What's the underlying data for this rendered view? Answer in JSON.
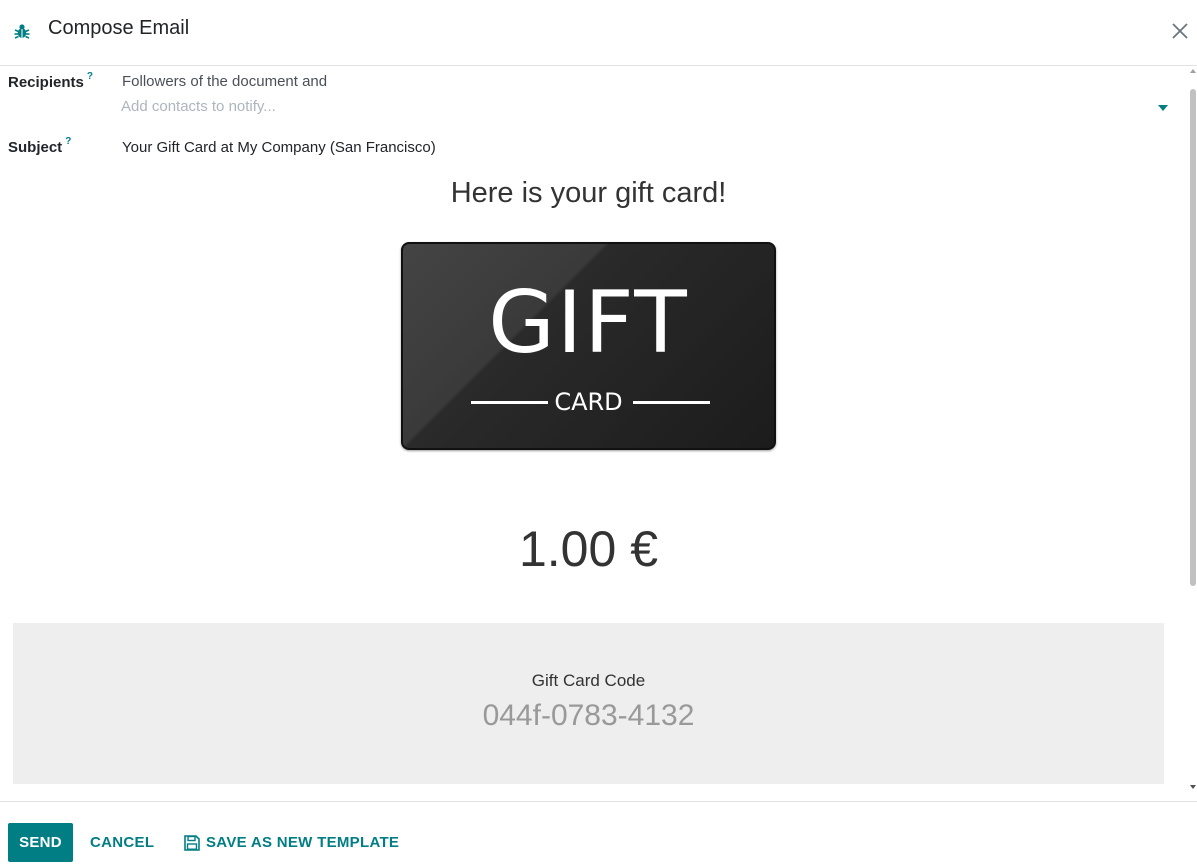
{
  "dialog": {
    "title": "Compose Email",
    "icons": {
      "header": "bug-icon",
      "close": "close-icon"
    }
  },
  "form": {
    "recipients": {
      "label": "Recipients",
      "help": "?",
      "followers_text": "Followers of the document and",
      "placeholder": "Add contacts to notify..."
    },
    "subject": {
      "label": "Subject",
      "help": "?",
      "value": "Your Gift Card at My Company (San Francisco)"
    }
  },
  "mail_body": {
    "heading": "Here is your gift card!",
    "card_image": {
      "big_text": "GIFT",
      "small_text": "CARD"
    },
    "amount": "1.00 €",
    "code_label": "Gift Card Code",
    "code_value": "044f-0783-4132"
  },
  "footer": {
    "send_label": "SEND",
    "cancel_label": "CANCEL",
    "save_template_label": "SAVE AS NEW TEMPLATE",
    "save_icon": "floppy-disk-icon"
  },
  "colors": {
    "accent": "#017e84",
    "code_background": "#eeeeee"
  }
}
